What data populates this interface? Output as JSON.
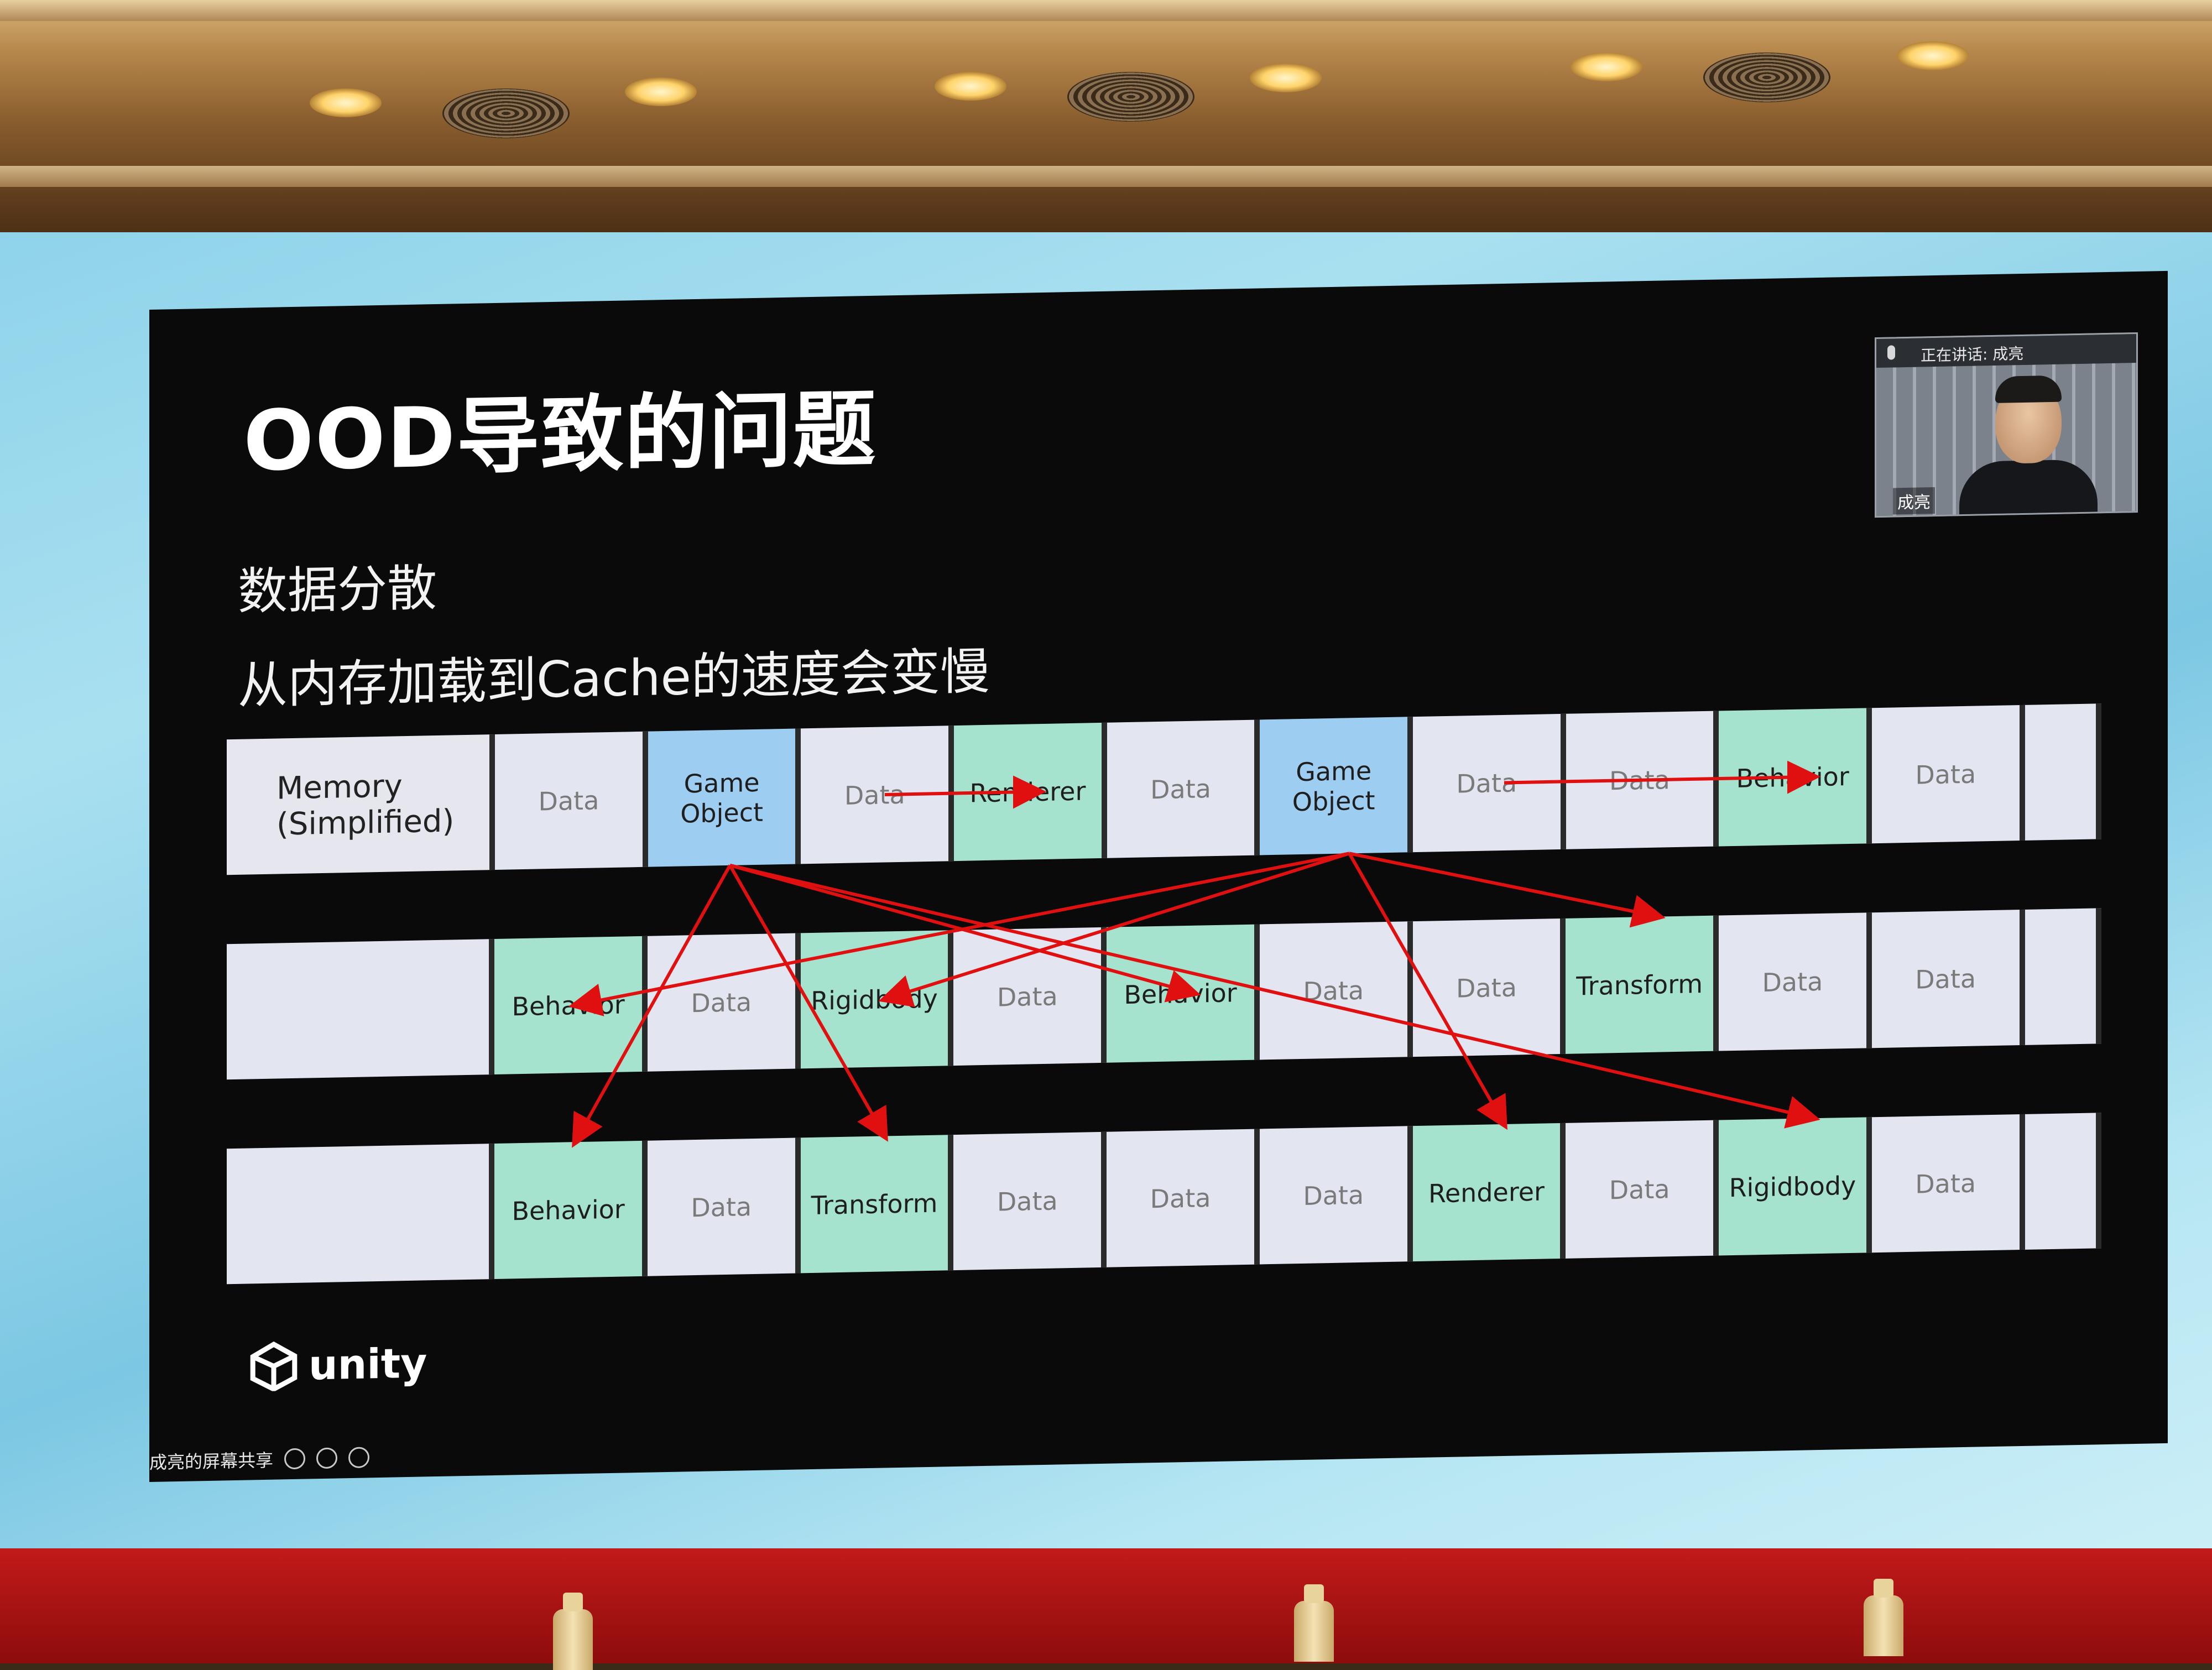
{
  "slide": {
    "title": "OOD导致的问题",
    "bullets": [
      "数据分散",
      "从内存加载到Cache的速度会变慢"
    ],
    "logo_text": "unity"
  },
  "diagram": {
    "rows": [
      {
        "cells": [
          {
            "label": "Memory\n(Simplified)",
            "kind": "memory"
          },
          {
            "label": "Data",
            "kind": "data"
          },
          {
            "label": "Game\nObject",
            "kind": "go"
          },
          {
            "label": "Data",
            "kind": "data"
          },
          {
            "label": "Renderer",
            "kind": "comp"
          },
          {
            "label": "Data",
            "kind": "data"
          },
          {
            "label": "Game\nObject",
            "kind": "go"
          },
          {
            "label": "Data",
            "kind": "data"
          },
          {
            "label": "Data",
            "kind": "data"
          },
          {
            "label": "Behavior",
            "kind": "comp"
          },
          {
            "label": "Data",
            "kind": "data"
          },
          {
            "label": "",
            "kind": "blank"
          }
        ]
      },
      {
        "cells": [
          {
            "label": "",
            "kind": "blank"
          },
          {
            "label": "Behavior",
            "kind": "comp"
          },
          {
            "label": "Data",
            "kind": "data"
          },
          {
            "label": "Rigidbody",
            "kind": "comp"
          },
          {
            "label": "Data",
            "kind": "data"
          },
          {
            "label": "Behavior",
            "kind": "comp"
          },
          {
            "label": "Data",
            "kind": "data"
          },
          {
            "label": "Data",
            "kind": "data"
          },
          {
            "label": "Transform",
            "kind": "comp"
          },
          {
            "label": "Data",
            "kind": "data"
          },
          {
            "label": "Data",
            "kind": "data"
          },
          {
            "label": "",
            "kind": "blank"
          }
        ]
      },
      {
        "cells": [
          {
            "label": "",
            "kind": "blank"
          },
          {
            "label": "Behavior",
            "kind": "comp"
          },
          {
            "label": "Data",
            "kind": "data"
          },
          {
            "label": "Transform",
            "kind": "comp"
          },
          {
            "label": "Data",
            "kind": "data"
          },
          {
            "label": "Data",
            "kind": "data"
          },
          {
            "label": "Data",
            "kind": "data"
          },
          {
            "label": "Renderer",
            "kind": "comp"
          },
          {
            "label": "Data",
            "kind": "data"
          },
          {
            "label": "Rigidbody",
            "kind": "comp"
          },
          {
            "label": "Data",
            "kind": "data"
          },
          {
            "label": "",
            "kind": "blank"
          }
        ]
      }
    ]
  },
  "webcam": {
    "caption": "正在讲话: 成亮",
    "name": "成亮"
  },
  "meeting_toolbar": {
    "share_label": "成亮的屏幕共享"
  },
  "colors": {
    "slide_bg": "#0a0a0a",
    "data_cell": "#e3e5f0",
    "component_cell": "#a6e3cf",
    "gameobject_cell": "#9dcdf0",
    "arrow": "#e01010",
    "stage": "#c21a1a",
    "screen_frame": "#8fd3ea"
  }
}
